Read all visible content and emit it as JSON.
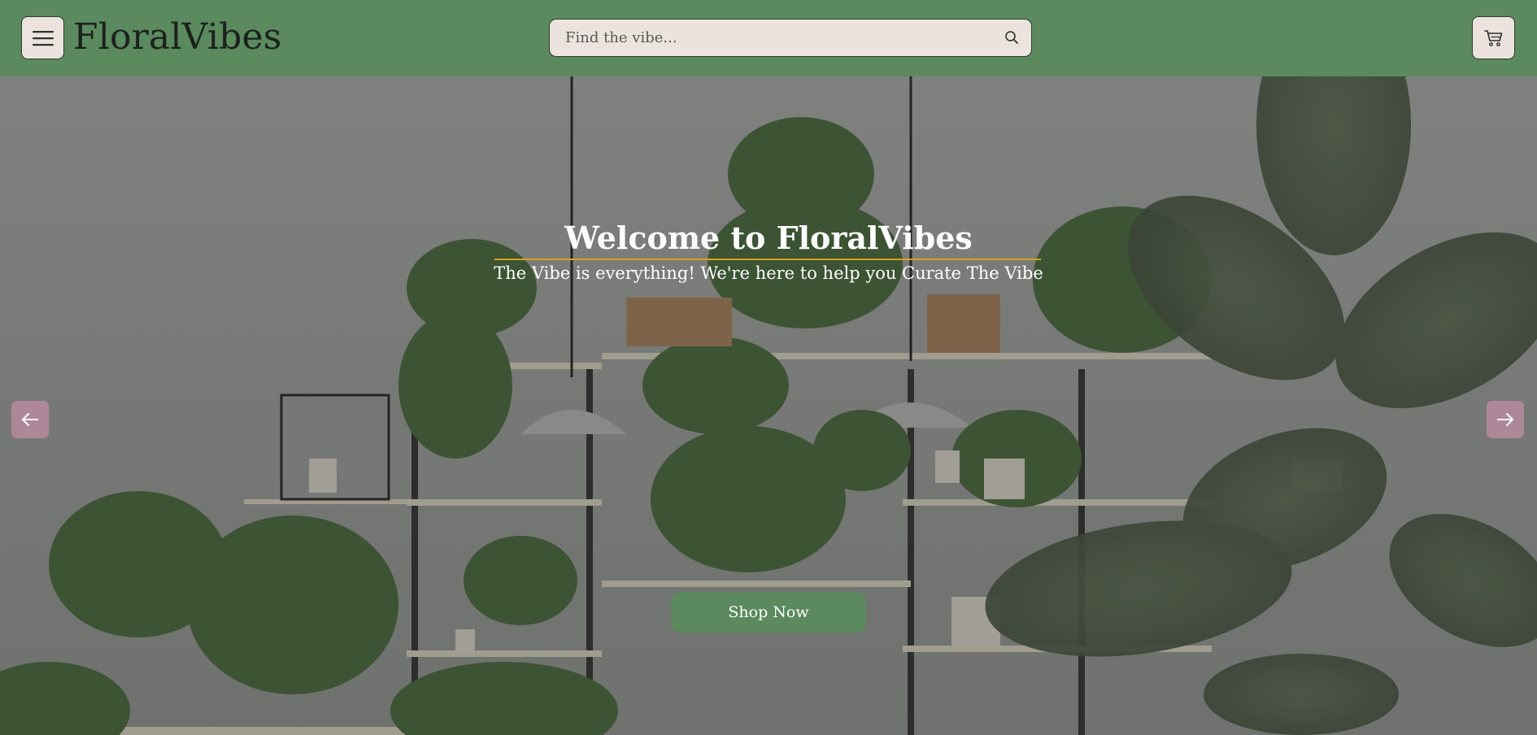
{
  "header": {
    "logo_text": "FloralVibes",
    "menu_icon": "hamburger-menu-icon",
    "search": {
      "placeholder": "Find the vibe...",
      "value": "",
      "icon": "search-icon"
    },
    "cart_icon": "shopping-cart-icon",
    "background_color": "#5a8a5e"
  },
  "hero": {
    "title": "Welcome to FloralVibes",
    "subtitle": "The Vibe is everything! We're here to help you Curate The Vibe",
    "cta_label": "Shop Now",
    "prev_icon": "arrow-left-icon",
    "next_icon": "arrow-right-icon",
    "accent_rule_color": "#d6a21c"
  }
}
